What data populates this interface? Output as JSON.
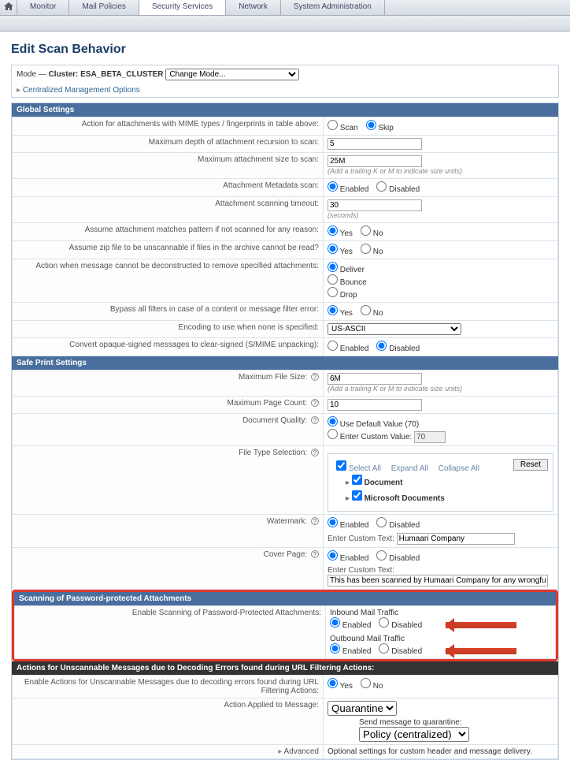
{
  "tabs": {
    "monitor": "Monitor",
    "mail_policies": "Mail Policies",
    "security_services": "Security Services",
    "network": "Network",
    "sysadmin": "System Administration"
  },
  "page_title": "Edit Scan Behavior",
  "mode": {
    "label": "Mode —",
    "cluster_label": "Cluster: ESA_BETA_CLUSTER",
    "change": "Change Mode..."
  },
  "centralized": "Centralized Management Options",
  "sections": {
    "global": "Global Settings",
    "safeprint": "Safe Print Settings",
    "pwd": "Scanning of Password-protected Attachments"
  },
  "rows": {
    "mime": "Action for attachments with MIME types / fingerprints in table above:",
    "depth": "Maximum depth of attachment recursion to scan:",
    "size": "Maximum attachment size to scan:",
    "meta": "Attachment Metadata scan:",
    "timeout": "Attachment scanning timeout:",
    "assume": "Assume attachment matches pattern if not scanned for any reason:",
    "zip": "Assume zip file to be unscannable if files in the archive cannot be read?",
    "deconstruct": "Action when message cannot be deconstructed to remove specified attachments:",
    "bypass": "Bypass all filters in case of a content or message filter error:",
    "encoding": "Encoding to use when none is specified:",
    "opaque": "Convert opaque-signed messages to clear-signed (S/MIME unpacking):",
    "maxfile": "Maximum File Size:",
    "maxpage": "Maximum Page Count:",
    "quality": "Document Quality:",
    "filetype": "File Type Selection:",
    "watermark": "Watermark:",
    "cover": "Cover Page:",
    "enablepwd": "Enable Scanning of Password-Protected Attachments:",
    "unscannablestrike": "Actions for Unscannable Messages due to Decoding Errors found during URL Filtering Actions:",
    "urlfilter": "Enable Actions for Unscannable Messages due to decoding errors found during URL Filtering Actions:",
    "applied": "Action Applied to Message:",
    "advanced": "Advanced"
  },
  "vals": {
    "scan": "Scan",
    "skip": "Skip",
    "enabled": "Enabled",
    "disabled": "Disabled",
    "yes": "Yes",
    "no": "No",
    "depth": "5",
    "size": "25M",
    "size_hint": "(Add a trailing K or M to indicate size units)",
    "timeout": "30",
    "timeout_hint": "(seconds)",
    "deliver": "Deliver",
    "bounce": "Bounce",
    "drop": "Drop",
    "encoding": "US-ASCII",
    "maxfile": "6M",
    "maxfile_hint": "(Add a trailing K or M to indicate size units)",
    "maxpage": "10",
    "usedef": "Use Default Value (70)",
    "custom": "Enter Custom Value:",
    "customval": "70",
    "selectall": "Select All",
    "expand": "Expand All",
    "collapse": "Collapse All",
    "reset": "Reset",
    "document": "Document",
    "msdoc": "Microsoft Documents",
    "entertext": "Enter Custom Text:",
    "watermark_text": "Humaari Company",
    "cover_text": "This has been scanned by Humaari Company for any wrongful activity!!!",
    "inbound": "Inbound Mail Traffic",
    "outbound": "Outbound Mail Traffic",
    "quarantine": "Quarantine",
    "sendmsg": "Send message to quarantine:",
    "policy": "Policy (centralized)",
    "adv_desc": "Optional settings for custom header and message delivery."
  }
}
